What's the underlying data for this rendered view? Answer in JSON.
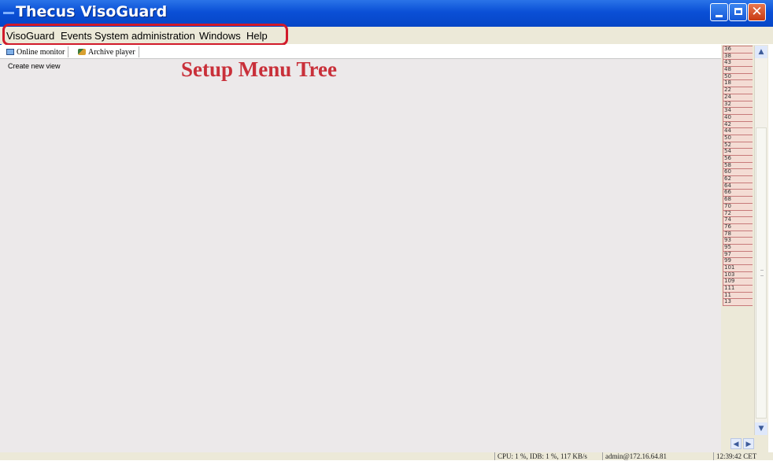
{
  "window": {
    "title": "Thecus VisoGuard",
    "minimize_glyph": "",
    "maximize_glyph": "",
    "close_glyph": "✕"
  },
  "menu": {
    "items": [
      "VisoGuard",
      "Events",
      "System administration",
      "Windows",
      "Help"
    ]
  },
  "annotation": {
    "label": "Setup Menu Tree",
    "color": "#c9303a"
  },
  "tabs": [
    {
      "label": "Online monitor",
      "icon": "monitor-icon"
    },
    {
      "label": "Archive player",
      "icon": "archive-icon"
    }
  ],
  "main": {
    "create_view_label": "Create new view"
  },
  "camera_list": [
    "36",
    "38",
    "43",
    "48",
    "50",
    "18",
    "22",
    "24",
    "32",
    "34",
    "40",
    "42",
    "44",
    "50",
    "52",
    "54",
    "56",
    "58",
    "60",
    "62",
    "64",
    "66",
    "68",
    "70",
    "72",
    "74",
    "76",
    "78",
    "93",
    "95",
    "97",
    "99",
    "101",
    "103",
    "109",
    "111",
    "11",
    "13"
  ],
  "status": {
    "cpu": "CPU: 1 %, IDB: 1 %, 117 KB/s",
    "user": "admin@172.16.64.81",
    "time": "12:39:42 CET"
  },
  "colors": {
    "titlebar": "#0a4fd6",
    "highlight_border": "#d11a2a",
    "camera_cell_bg": "#f4dcd4"
  }
}
